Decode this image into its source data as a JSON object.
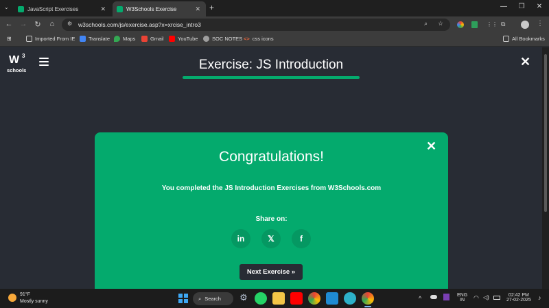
{
  "browser": {
    "tabs": [
      {
        "label": "JavaScript Exercises",
        "active": false
      },
      {
        "label": "W3Schools Exercise",
        "active": true
      }
    ],
    "new_tab": "+",
    "window_controls": {
      "minimize": "—",
      "restore": "❐",
      "close": "✕"
    },
    "address": "w3schools.com/js/exercise.asp?x=xrcise_intro3",
    "bookmarks": [
      {
        "label": "Imported From IE",
        "icon": "folder-icon",
        "color": "#c8c8c8"
      },
      {
        "label": "Translate",
        "icon": "translate-icon",
        "color": "#4285f4"
      },
      {
        "label": "Maps",
        "icon": "maps-icon",
        "color": "#34a853"
      },
      {
        "label": "Gmail",
        "icon": "gmail-icon",
        "color": "#ea4335"
      },
      {
        "label": "YouTube",
        "icon": "youtube-icon",
        "color": "#ff0000"
      },
      {
        "label": "SOC NOTES",
        "icon": "globe-icon",
        "color": "#9e9e9e"
      },
      {
        "label": "css icons",
        "icon": "code-icon",
        "color": "#e8663d"
      }
    ],
    "all_bookmarks": "All Bookmarks"
  },
  "page": {
    "logo_main": "W",
    "logo_sup": "3",
    "logo_sub": "schools",
    "title": "Exercise: JS Introduction",
    "close": "✕"
  },
  "modal": {
    "close": "✕",
    "heading": "Congratulations!",
    "message": "You completed the JS Introduction Exercises from W3Schools.com",
    "share_label": "Share on:",
    "social": [
      {
        "name": "linkedin",
        "glyph": "in"
      },
      {
        "name": "x",
        "glyph": "𝕏"
      },
      {
        "name": "facebook",
        "glyph": "f"
      }
    ],
    "next_button": "Next Exercise »"
  },
  "taskbar": {
    "weather_temp": "91°F",
    "weather_desc": "Mostly sunny",
    "search_label": "Search",
    "language": "ENG",
    "language_region": "IN",
    "time": "02:42 PM",
    "date": "27-02-2025"
  },
  "colors": {
    "accent": "#04aa6d",
    "page_bg": "#282c34"
  }
}
